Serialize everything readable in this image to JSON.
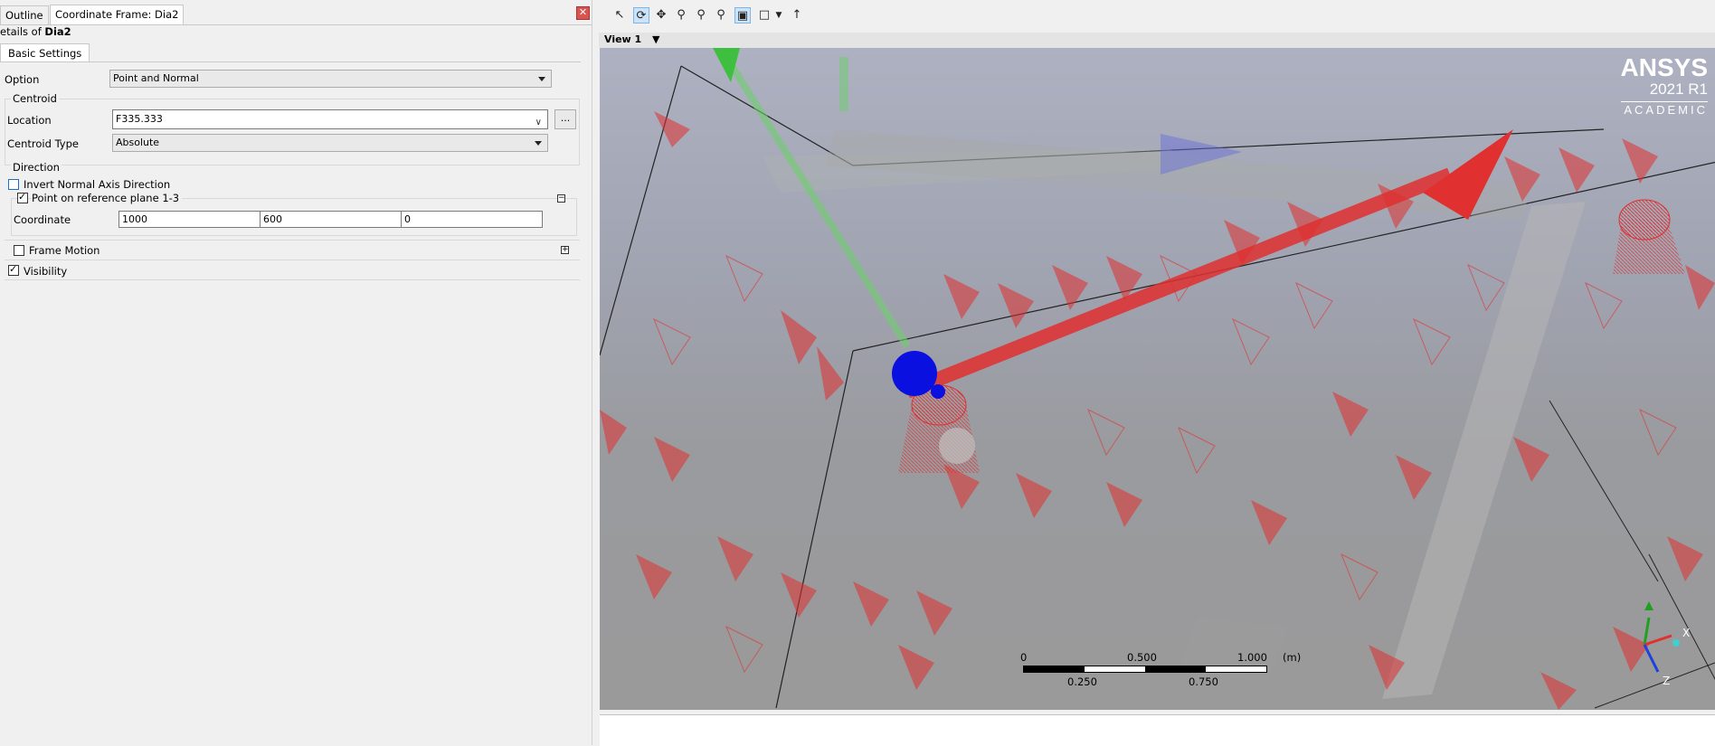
{
  "tabs": [
    {
      "label": "Outline"
    },
    {
      "label": "Coordinate Frame: Dia2"
    }
  ],
  "details": {
    "prefix": "etails of ",
    "name": "Dia2"
  },
  "subtab": "Basic Settings",
  "form": {
    "option_label": "Option",
    "option_value": "Point and Normal",
    "centroid_group": "Centroid",
    "location_label": "Location",
    "location_value": "F335.333",
    "location_button": "...",
    "centroid_type_label": "Centroid Type",
    "centroid_type_value": "Absolute",
    "direction_group": "Direction",
    "invert_normal_label": "Invert Normal Axis Direction",
    "point_plane_label": "Point on reference plane 1-3",
    "coordinate_label": "Coordinate",
    "coordinate_values": [
      "1000",
      "600",
      "0"
    ],
    "frame_motion_label": "Frame Motion",
    "visibility_label": "Visibility"
  },
  "toolbar": {
    "icons": [
      "select-icon",
      "rotate-icon",
      "pan-icon",
      "zoom-icon",
      "zoom-box-icon",
      "zoom-fit-icon",
      "highlight-icon",
      "viewport-layout-icon",
      "dropdown-icon",
      "probe-icon"
    ]
  },
  "viewport": {
    "view_label": "View 1",
    "brand": {
      "name": "ANSYS",
      "version": "2021 R1",
      "edition": "ACADEMIC"
    },
    "scale": {
      "top_labels": [
        "0",
        "0.500",
        "1.000",
        "(m)"
      ],
      "bottom_labels": [
        "0.250",
        "0.750"
      ]
    },
    "axes": {
      "x": "X",
      "z": "Z"
    }
  },
  "colors": {
    "accent": "#1e6fc8",
    "arrow_red": "#e03030",
    "sphere_blue": "#0a10e0",
    "close_red": "#d9534f"
  }
}
